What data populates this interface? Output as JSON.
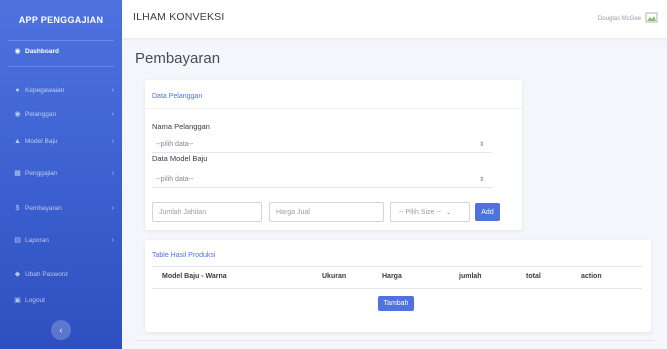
{
  "sidebar": {
    "brand": "APP PENGGAJIAN",
    "items": [
      {
        "label": "Dashboard",
        "icon": "dashboard-icon",
        "active": true
      },
      {
        "label": "Kepegawaian",
        "icon": "user-icon",
        "chevron": true
      },
      {
        "label": "Pelanggan",
        "icon": "users-icon",
        "chevron": true
      },
      {
        "label": "Model Baju",
        "icon": "shirt-icon",
        "chevron": true
      },
      {
        "label": "Penggajian",
        "icon": "table-icon",
        "chevron": true
      },
      {
        "label": "Pembayaran",
        "icon": "money-icon",
        "chevron": true
      },
      {
        "label": "Laporan",
        "icon": "report-icon",
        "chevron": true
      },
      {
        "label": "Ubah Pasword",
        "icon": "key-icon"
      },
      {
        "label": "Logout",
        "icon": "logout-icon"
      }
    ],
    "toggle": "‹"
  },
  "topbar": {
    "title": "ILHAM KONVEKSI",
    "user": "Douglas McGee"
  },
  "page": {
    "title": "Pembayaran"
  },
  "form": {
    "header": "Data Pelanggan",
    "label_pelanggan": "Nama Pelanggan",
    "select_pelanggan": "--pilih data--",
    "label_model": "Data Model Baju",
    "select_model": "--pilih data--",
    "jumlah_placeholder": "Jumlah Jahitan",
    "harga_placeholder": "Harga Jual",
    "size_select": "-- Pilih Size --",
    "add_button": "Add"
  },
  "table": {
    "header": "Table Hasil Produksi",
    "columns": [
      "Model Baju - Warna",
      "Ukuran",
      "Harga",
      "jumlah",
      "total",
      "action"
    ],
    "save_button": "Tambah"
  },
  "colors": {
    "primary": "#4e73df",
    "sidebar_gradient_end": "#2e4fbf"
  }
}
